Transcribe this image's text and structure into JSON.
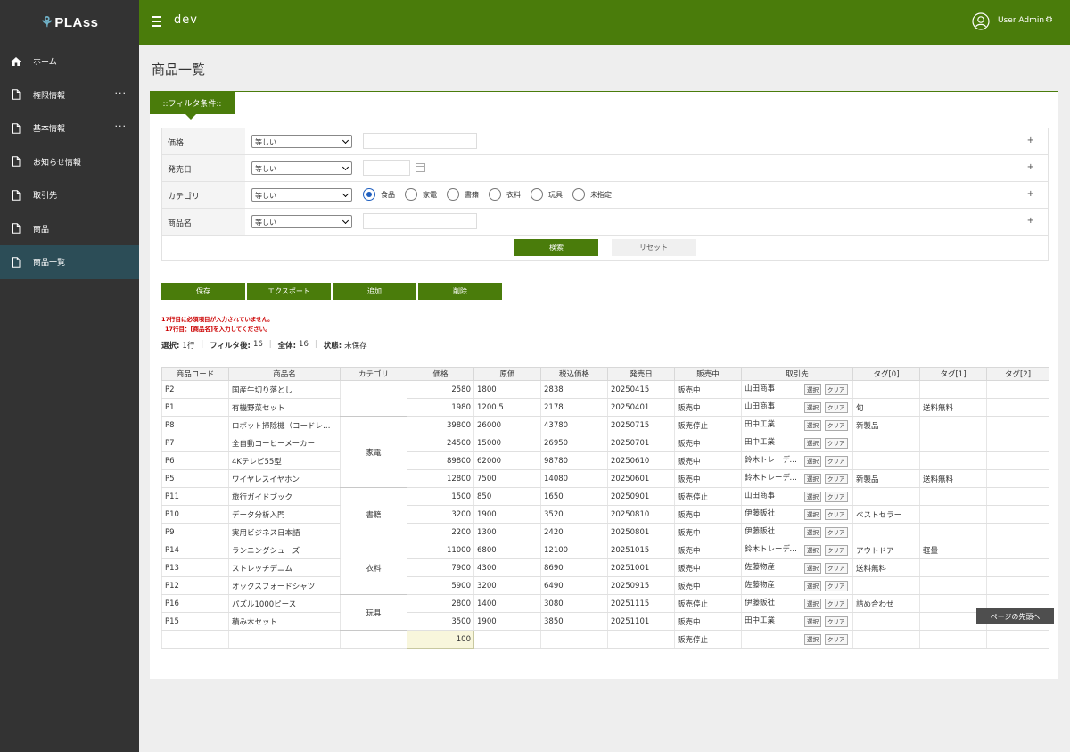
{
  "app": {
    "logo": "PLAss",
    "title": "dev"
  },
  "header": {
    "user": "User Admin"
  },
  "sidebar": {
    "items": [
      {
        "label": "ホーム",
        "icon": "home-icon"
      },
      {
        "label": "権限情報",
        "icon": "document-icon",
        "more": "···"
      },
      {
        "label": "基本情報",
        "icon": "document-icon",
        "more": "···"
      },
      {
        "label": "お知らせ情報",
        "icon": "document-icon"
      },
      {
        "label": "取引先",
        "icon": "document-icon"
      },
      {
        "label": "商品",
        "icon": "document-icon"
      },
      {
        "label": "商品一覧",
        "icon": "document-icon",
        "active": true
      }
    ]
  },
  "page": {
    "title": "商品一覧"
  },
  "filter": {
    "tab_label": "::フィルタ条件::",
    "rows": [
      {
        "label": "価格",
        "op": "等しい"
      },
      {
        "label": "発売日",
        "op": "等しい"
      },
      {
        "label": "カテゴリ",
        "op": "等しい"
      },
      {
        "label": "商品名",
        "op": "等しい"
      }
    ],
    "plus": "+",
    "categories": [
      "食品",
      "家電",
      "書籍",
      "衣料",
      "玩具",
      "未指定"
    ],
    "selected_category": "食品",
    "search_label": "検索",
    "reset_label": "リセット"
  },
  "actions": {
    "save": "保存",
    "export": "エクスポート",
    "add": "追加",
    "delete": "削除"
  },
  "errors": [
    "17行目に必須項目が入力されていません。",
    "17行目：[商品名]を入力してください。"
  ],
  "status": {
    "selected_label": "選択:",
    "selected_value": "1行",
    "filtered_label": "フィルタ後:",
    "filtered_value": "16",
    "total_label": "全体:",
    "total_value": "16",
    "state_label": "状態:",
    "state_value": "未保存"
  },
  "grid": {
    "columns": [
      "商品コード",
      "商品名",
      "カテゴリ",
      "価格",
      "原価",
      "税込価格",
      "発売日",
      "販売中",
      "取引先",
      "タグ[0]",
      "タグ[1]",
      "タグ[2]"
    ],
    "select_label": "選択",
    "clear_label": "クリア",
    "groups": [
      {
        "category": "",
        "rows": [
          {
            "code": "P2",
            "name": "国産牛切り落とし",
            "price": "2580",
            "cost": "1800",
            "tax": "2838",
            "date": "20250415",
            "status": "販売中",
            "vendor": "山田商事",
            "tag0": "",
            "tag1": "",
            "tag2": ""
          },
          {
            "code": "P1",
            "name": "有機野菜セット",
            "price": "1980",
            "cost": "1200.5",
            "tax": "2178",
            "date": "20250401",
            "status": "販売中",
            "vendor": "山田商事",
            "tag0": "旬",
            "tag1": "送料無料",
            "tag2": ""
          }
        ]
      },
      {
        "category": "家電",
        "rows": [
          {
            "code": "P8",
            "name": "ロボット掃除機（コードレス）",
            "price": "39800",
            "cost": "26000",
            "tax": "43780",
            "date": "20250715",
            "status": "販売停止",
            "vendor": "田中工業",
            "tag0": "新製品",
            "tag1": "",
            "tag2": ""
          },
          {
            "code": "P7",
            "name": "全自動コーヒーメーカー",
            "price": "24500",
            "cost": "15000",
            "tax": "26950",
            "date": "20250701",
            "status": "販売中",
            "vendor": "田中工業",
            "tag0": "",
            "tag1": "",
            "tag2": ""
          },
          {
            "code": "P6",
            "name": "4Kテレビ55型",
            "price": "89800",
            "cost": "62000",
            "tax": "98780",
            "date": "20250610",
            "status": "販売中",
            "vendor": "鈴木トレーディング",
            "tag0": "",
            "tag1": "",
            "tag2": ""
          },
          {
            "code": "P5",
            "name": "ワイヤレスイヤホン",
            "price": "12800",
            "cost": "7500",
            "tax": "14080",
            "date": "20250601",
            "status": "販売中",
            "vendor": "鈴木トレーディング",
            "tag0": "新製品",
            "tag1": "送料無料",
            "tag2": ""
          }
        ]
      },
      {
        "category": "書籍",
        "rows": [
          {
            "code": "P11",
            "name": "旅行ガイドブック",
            "price": "1500",
            "cost": "850",
            "tax": "1650",
            "date": "20250901",
            "status": "販売停止",
            "vendor": "山田商事",
            "tag0": "",
            "tag1": "",
            "tag2": ""
          },
          {
            "code": "P10",
            "name": "データ分析入門",
            "price": "3200",
            "cost": "1900",
            "tax": "3520",
            "date": "20250810",
            "status": "販売中",
            "vendor": "伊藤販社",
            "tag0": "ベストセラー",
            "tag1": "",
            "tag2": ""
          },
          {
            "code": "P9",
            "name": "実用ビジネス日本語",
            "price": "2200",
            "cost": "1300",
            "tax": "2420",
            "date": "20250801",
            "status": "販売中",
            "vendor": "伊藤販社",
            "tag0": "",
            "tag1": "",
            "tag2": ""
          }
        ]
      },
      {
        "category": "衣料",
        "rows": [
          {
            "code": "P14",
            "name": "ランニングシューズ",
            "price": "11000",
            "cost": "6800",
            "tax": "12100",
            "date": "20251015",
            "status": "販売中",
            "vendor": "鈴木トレーディング",
            "tag0": "アウトドア",
            "tag1": "軽量",
            "tag2": ""
          },
          {
            "code": "P13",
            "name": "ストレッチデニム",
            "price": "7900",
            "cost": "4300",
            "tax": "8690",
            "date": "20251001",
            "status": "販売中",
            "vendor": "佐藤物産",
            "tag0": "送料無料",
            "tag1": "",
            "tag2": ""
          },
          {
            "code": "P12",
            "name": "オックスフォードシャツ",
            "price": "5900",
            "cost": "3200",
            "tax": "6490",
            "date": "20250915",
            "status": "販売中",
            "vendor": "佐藤物産",
            "tag0": "",
            "tag1": "",
            "tag2": ""
          }
        ]
      },
      {
        "category": "玩具",
        "rows": [
          {
            "code": "P16",
            "name": "パズル1000ピース",
            "price": "2800",
            "cost": "1400",
            "tax": "3080",
            "date": "20251115",
            "status": "販売停止",
            "vendor": "伊藤販社",
            "tag0": "詰め合わせ",
            "tag1": "",
            "tag2": ""
          },
          {
            "code": "P15",
            "name": "積み木セット",
            "price": "3500",
            "cost": "1900",
            "tax": "3850",
            "date": "20251101",
            "status": "販売中",
            "vendor": "田中工業",
            "tag0": "",
            "tag1": "",
            "tag2": ""
          }
        ]
      }
    ],
    "new_row": {
      "code": "",
      "name": "",
      "price": "100",
      "cost": "",
      "tax": "",
      "date": "",
      "status": "販売停止",
      "vendor": "",
      "tag0": "",
      "tag1": "",
      "tag2": ""
    }
  },
  "back_to_top": "ページの先頭へ"
}
